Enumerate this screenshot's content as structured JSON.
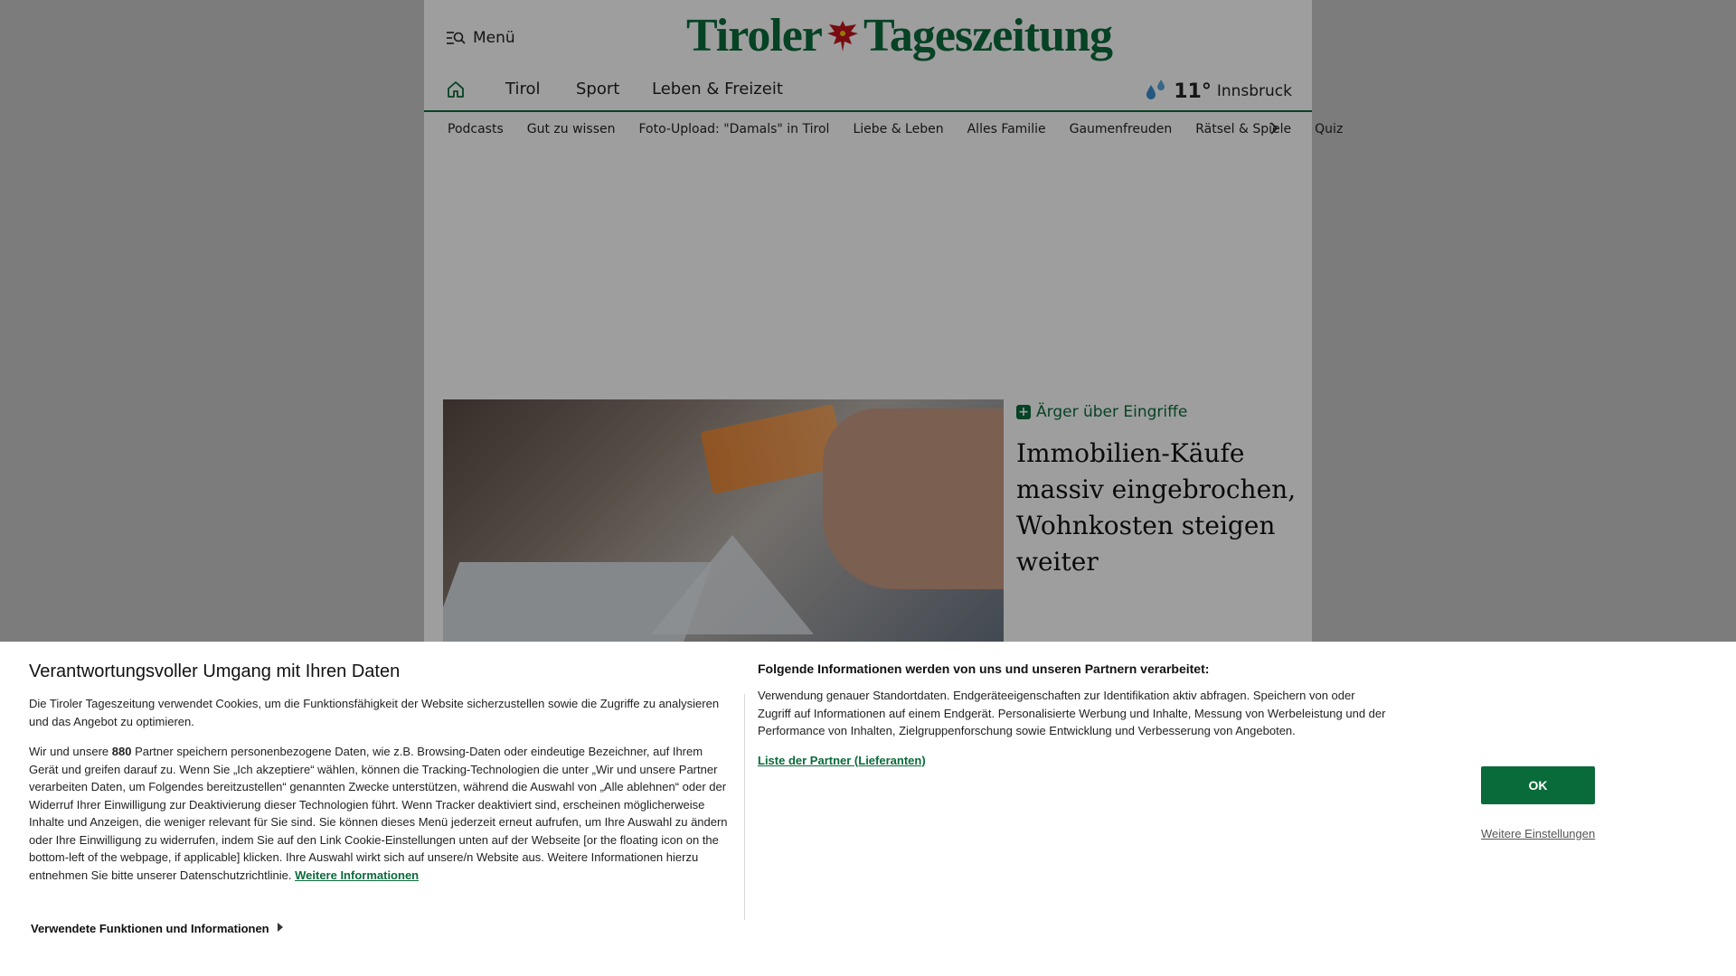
{
  "header": {
    "menu_label": "Menü",
    "logo_left": "Tiroler",
    "logo_right": "Tageszeitung"
  },
  "main_nav": {
    "items": [
      "Tirol",
      "Sport",
      "Leben & Freizeit"
    ]
  },
  "weather": {
    "temperature": "11°",
    "city": "Innsbruck"
  },
  "sub_nav": {
    "items": [
      "Podcasts",
      "Gut zu wissen",
      "Foto-Upload: \"Damals\" in Tirol",
      "Liebe & Leben",
      "Alles Familie",
      "Gaumenfreuden",
      "Rätsel & Spiele",
      "Quiz"
    ]
  },
  "teaser": {
    "kicker": "Ärger über Eingriffe",
    "headline": "Immobilien-Käufe massiv eingebrochen, Wohnkosten steigen weiter"
  },
  "consent": {
    "title": "Verantwortungsvoller Umgang mit Ihren Daten",
    "intro": "Die Tiroler Tageszeitung verwendet Cookies, um die Funktionsfähigkeit der Website sicherzustellen sowie die Zugriffe zu analysieren und das Angebot zu optimieren.",
    "body_pre": "Wir und unsere ",
    "partner_count": "880",
    "body_post": " Partner speichern personenbezogene Daten, wie z.B. Browsing-Daten oder eindeutige Bezeichner, auf Ihrem Gerät und greifen darauf zu. Wenn Sie „Ich akzeptiere“ wählen, können die Tracking-Technologien die unter „Wir und unsere Partner verarbeiten Daten, um Folgendes bereitzustellen“ genannten Zwecke unterstützen, während die Auswahl von „Alle ablehnen“ oder der Widerruf Ihrer Einwilligung zur Deaktivierung dieser Technologien führt. Wenn Tracker deaktiviert sind, erscheinen möglicherweise Inhalte und Anzeigen, die weniger relevant für Sie sind. Sie können dieses Menü jederzeit erneut aufrufen, um Ihre Auswahl zu ändern oder Ihre Einwilligung zu widerrufen, indem Sie auf den Link Cookie-Einstellungen unten auf der Webseite [or the floating icon on the bottom-left of the webpage, if applicable] klicken. Ihre Auswahl wirkt sich auf unsere/n Website aus. Weitere Informationen hierzu entnehmen Sie bitte unserer Datenschutzrichtlinie. ",
    "more_info_link": "Weitere Informationen",
    "functions_label": "Verwendete Funktionen und Informationen",
    "info_title": "Folgende Informationen werden von uns und unseren Partnern verarbeitet:",
    "info_text": "Verwendung genauer Standortdaten. Endgeräteeigenschaften zur Identifikation aktiv abfragen. Speichern von oder Zugriff auf Informationen auf einem Endgerät. Personalisierte Werbung und Inhalte, Messung von Werbeleistung und der Performance von Inhalten, Zielgruppenforschung sowie Entwicklung und Verbesserung von Angeboten.",
    "partner_list_link": "Liste der Partner (Lieferanten)",
    "ok_button": "OK",
    "more_settings": "Weitere Einstellungen"
  },
  "colors": {
    "brand_green": "#0a6b3a",
    "overlay": "rgba(0,0,0,0.38)"
  }
}
